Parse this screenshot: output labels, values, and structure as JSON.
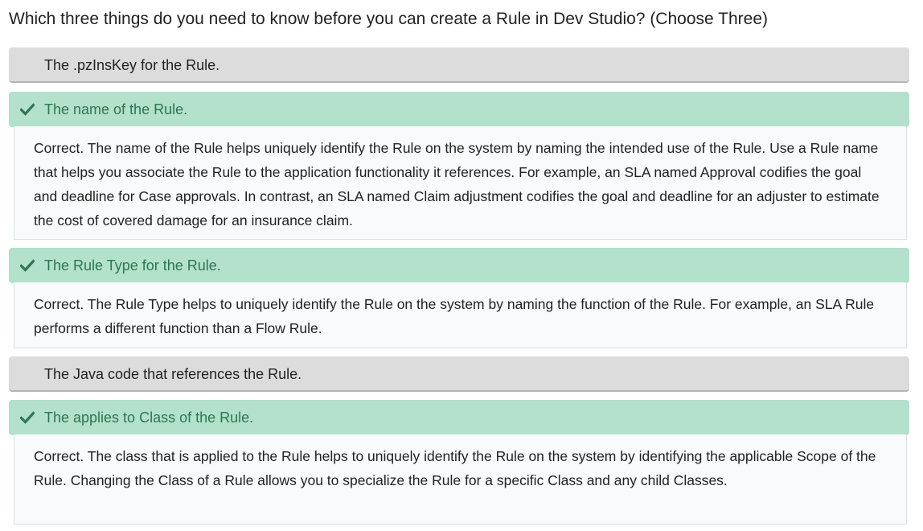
{
  "question": {
    "text": "Which three things do you need to know before you can create a Rule in Dev Studio? (Choose Three)"
  },
  "options": [
    {
      "label": "The .pzInsKey for the Rule.",
      "state": "not-selected"
    },
    {
      "label": "The name of the Rule.",
      "state": "correct",
      "feedback": "Correct. The name of the Rule helps uniquely identify the Rule on the system by naming the intended use of the Rule. Use a Rule name that helps you associate the Rule to the application functionality it references. For example, an SLA named Approval codifies the goal and deadline for Case approvals. In contrast, an SLA named Claim adjustment codifies the goal and deadline for an adjuster to estimate the cost of covered damage for an insurance claim."
    },
    {
      "label": "The Rule Type for the Rule.",
      "state": "correct",
      "feedback": "Correct. The Rule Type helps to uniquely identify the Rule on the system by naming the function of the Rule. For example, an SLA Rule performs a different function than a Flow Rule."
    },
    {
      "label": "The Java code that references the Rule.",
      "state": "not-selected"
    },
    {
      "label": "The applies to Class of the Rule.",
      "state": "correct",
      "feedback": "Correct. The class that is applied to the Rule helps to uniquely identify the Rule on the system by identifying the applicable Scope of the Rule. Changing the Class of a Rule allows you to specialize the Rule for a specific Class and any child Classes."
    }
  ],
  "icons": {
    "correct_icon": "checkmark-icon"
  },
  "colors": {
    "correct_bg": "#b3e1cb",
    "correct_text": "#2e7651",
    "neutral_bg": "#dcdcdc",
    "feedback_bg": "#f9fafb"
  }
}
